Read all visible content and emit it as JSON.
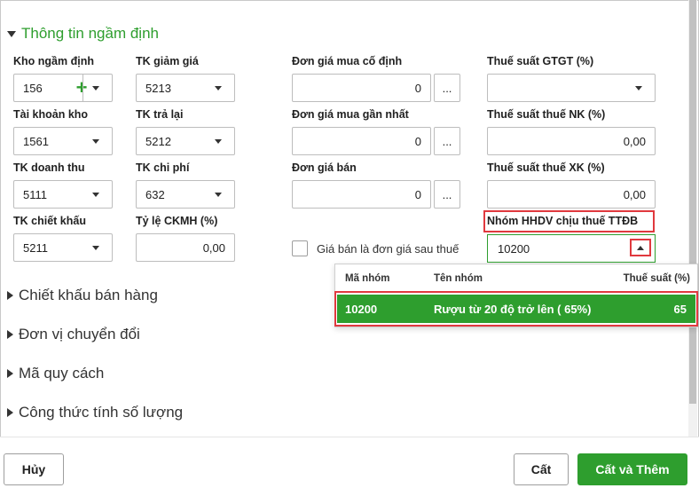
{
  "section_default": {
    "title": "Thông tin ngầm định"
  },
  "fields": {
    "kho_ngam_dinh": {
      "label": "Kho ngầm định",
      "value": "156"
    },
    "tk_giam_gia": {
      "label": "TK giảm giá",
      "value": "5213"
    },
    "don_gia_mua_co_dinh": {
      "label": "Đơn giá mua cố định",
      "value": "0"
    },
    "thue_suat_gtgt": {
      "label": "Thuế suất GTGT (%)",
      "value": ""
    },
    "tai_khoan_kho": {
      "label": "Tài khoản kho",
      "value": "1561"
    },
    "tk_tra_lai": {
      "label": "TK trả lại",
      "value": "5212"
    },
    "don_gia_mua_gan_nhat": {
      "label": "Đơn giá mua gần nhất",
      "value": "0"
    },
    "thue_suat_nk": {
      "label": "Thuế suất thuế NK (%)",
      "value": "0,00"
    },
    "tk_doanh_thu": {
      "label": "TK doanh thu",
      "value": "5111"
    },
    "tk_chi_phi": {
      "label": "TK chi phí",
      "value": "632"
    },
    "don_gia_ban": {
      "label": "Đơn giá bán",
      "value": "0"
    },
    "thue_suat_xk": {
      "label": "Thuế suất thuế XK (%)",
      "value": "0,00"
    },
    "tk_chiet_khau": {
      "label": "TK chiết khấu",
      "value": "5211"
    },
    "ty_le_ckmh": {
      "label": "Tỷ lệ CKMH (%)",
      "value": "0,00"
    },
    "nhom_hhdv": {
      "label": "Nhóm HHDV chịu thuế TTĐB",
      "value": "10200"
    }
  },
  "checkbox_gia_ban": {
    "label": "Giá bán là đơn giá sau thuế",
    "checked": false
  },
  "ellipsis": "...",
  "dropdown": {
    "columns": [
      "Mã nhóm",
      "Tên nhóm",
      "Thuế suất (%)"
    ],
    "rows": [
      {
        "ma": "10200",
        "ten": "Rượu từ 20 độ trở lên ( 65%)",
        "thue": "65"
      }
    ]
  },
  "sections": [
    {
      "title": "Chiết khấu bán hàng"
    },
    {
      "title": "Đơn vị chuyển đổi"
    },
    {
      "title": "Mã quy cách"
    },
    {
      "title": "Công thức tính số lượng"
    }
  ],
  "footer": {
    "cancel": "Hủy",
    "save": "Cất",
    "save_add": "Cất và Thêm"
  },
  "colors": {
    "accent": "#2e9e2e",
    "highlight": "#e0393e"
  }
}
